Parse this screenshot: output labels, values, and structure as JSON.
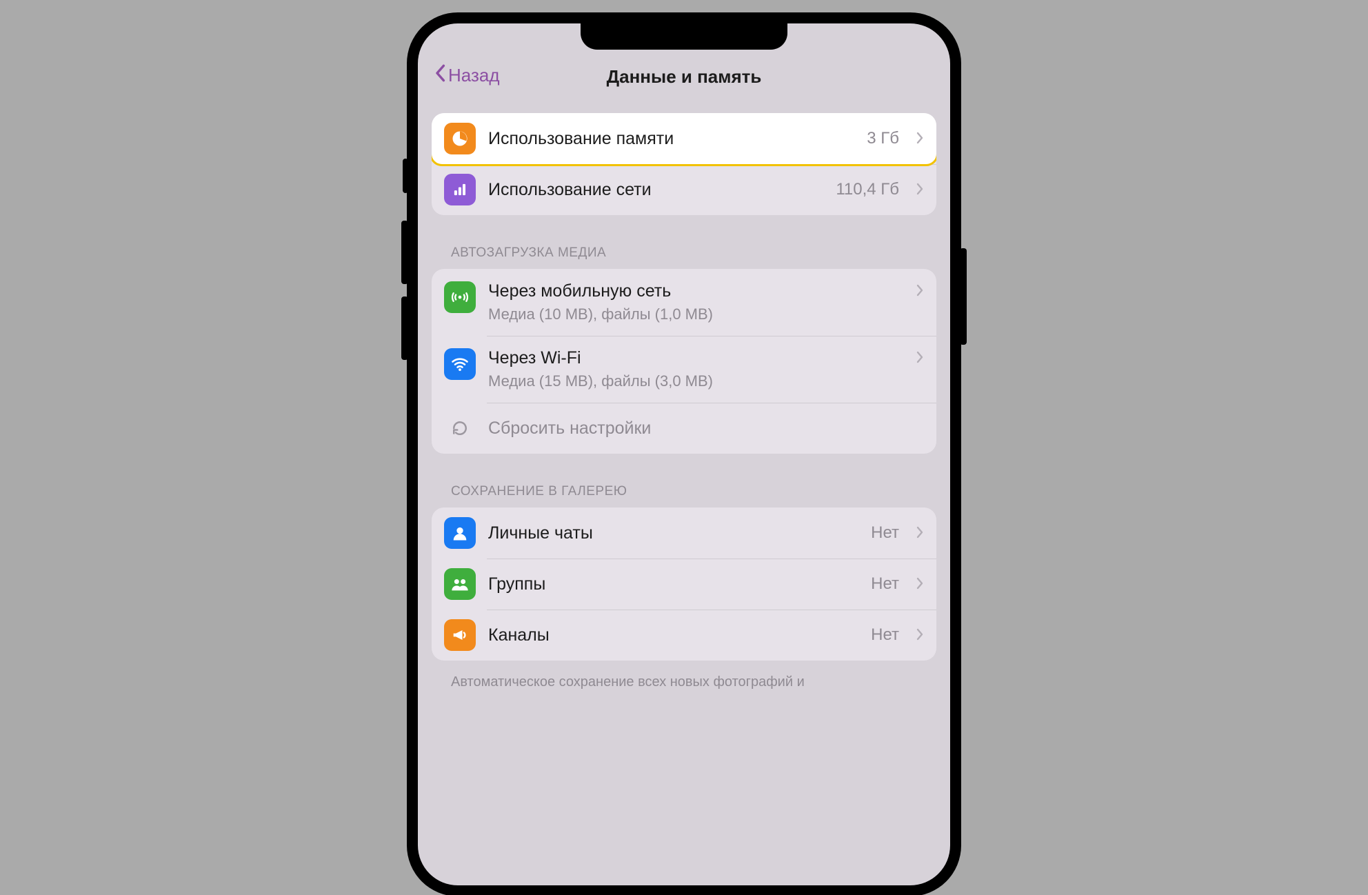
{
  "nav": {
    "back": "Назад",
    "title": "Данные и память"
  },
  "usage": {
    "storage": {
      "label": "Использование памяти",
      "value": "3 Гб"
    },
    "network": {
      "label": "Использование сети",
      "value": "110,4 Гб"
    }
  },
  "autoload": {
    "header": "АВТОЗАГРУЗКА МЕДИА",
    "cellular": {
      "label": "Через мобильную сеть",
      "sub": "Медиа (10 MB), файлы (1,0 MB)"
    },
    "wifi": {
      "label": "Через Wi-Fi",
      "sub": "Медиа (15 MB), файлы (3,0 MB)"
    },
    "reset": {
      "label": "Сбросить настройки"
    }
  },
  "save": {
    "header": "СОХРАНЕНИЕ В ГАЛЕРЕЮ",
    "private": {
      "label": "Личные чаты",
      "value": "Нет"
    },
    "groups": {
      "label": "Группы",
      "value": "Нет"
    },
    "channels": {
      "label": "Каналы",
      "value": "Нет"
    },
    "footer": "Автоматическое сохранение всех новых фотографий и"
  }
}
